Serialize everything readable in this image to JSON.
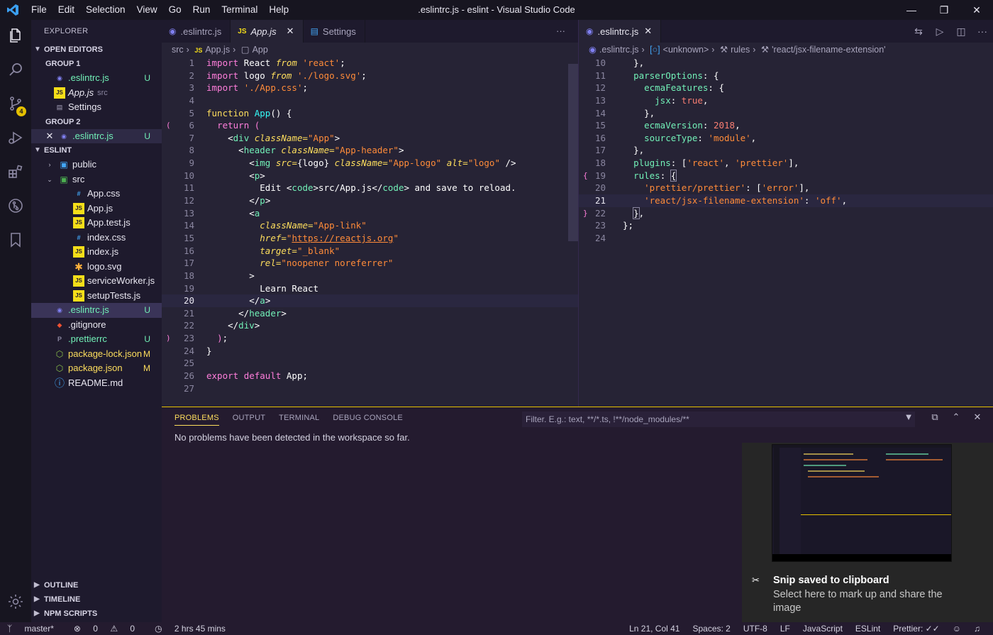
{
  "titlebar": {
    "menu": [
      "File",
      "Edit",
      "Selection",
      "View",
      "Go",
      "Run",
      "Terminal",
      "Help"
    ],
    "title": ".eslintrc.js - eslint - Visual Studio Code",
    "minimize": "—",
    "restore": "❐",
    "close": "✕"
  },
  "activity": {
    "scm_badge": "4"
  },
  "sidebar": {
    "header": "EXPLORER",
    "open_editors": "OPEN EDITORS",
    "group1": "GROUP 1",
    "group2": "GROUP 2",
    "g1_items": [
      {
        "name": ".eslintrc.js",
        "status": "U"
      },
      {
        "name": "App.js",
        "desc": "src"
      },
      {
        "name": "Settings"
      }
    ],
    "g2_items": [
      {
        "name": ".eslintrc.js",
        "status": "U"
      }
    ],
    "project": "ESLINT",
    "tree": [
      {
        "name": "public"
      },
      {
        "name": "src"
      },
      {
        "name": "App.css"
      },
      {
        "name": "App.js"
      },
      {
        "name": "App.test.js"
      },
      {
        "name": "index.css"
      },
      {
        "name": "index.js"
      },
      {
        "name": "logo.svg"
      },
      {
        "name": "serviceWorker.js"
      },
      {
        "name": "setupTests.js"
      },
      {
        "name": ".eslintrc.js",
        "status": "U"
      },
      {
        "name": ".gitignore"
      },
      {
        "name": ".prettierrc",
        "status": "U"
      },
      {
        "name": "package-lock.json",
        "status": "M"
      },
      {
        "name": "package.json",
        "status": "M"
      },
      {
        "name": "README.md"
      }
    ],
    "outline": "OUTLINE",
    "timeline": "TIMELINE",
    "npm": "NPM SCRIPTS"
  },
  "left_editor": {
    "tabs": [
      ".eslintrc.js",
      "App.js",
      "Settings"
    ],
    "more": "···",
    "breadcrumb": [
      "src",
      "App.js",
      "App"
    ]
  },
  "right_editor": {
    "tab": ".eslintrc.js",
    "breadcrumb": [
      ".eslintrc.js",
      "<unknown>",
      "rules",
      "'react/jsx-filename-extension'"
    ]
  },
  "panel": {
    "tabs": [
      "PROBLEMS",
      "OUTPUT",
      "TERMINAL",
      "DEBUG CONSOLE"
    ],
    "filter_placeholder": "Filter. E.g.: text, **/*.ts, !**/node_modules/**",
    "message": "No problems have been detected in the workspace so far."
  },
  "toast": {
    "title": "Snip saved to clipboard",
    "body": "Select here to mark up and share the image"
  },
  "statusbar": {
    "branch": "master*",
    "errors": "0",
    "warnings": "0",
    "time": "2 hrs 45 mins",
    "position": "Ln 21, Col 41",
    "spaces": "Spaces: 2",
    "encoding": "UTF-8",
    "eol": "LF",
    "language": "JavaScript",
    "eslint": "ESLint",
    "prettier": "Prettier: ✓✓"
  },
  "colors": {
    "accent": "#e5c000",
    "background": "#262335",
    "sidebar": "#1e1a2d",
    "activitybar": "#171520"
  }
}
